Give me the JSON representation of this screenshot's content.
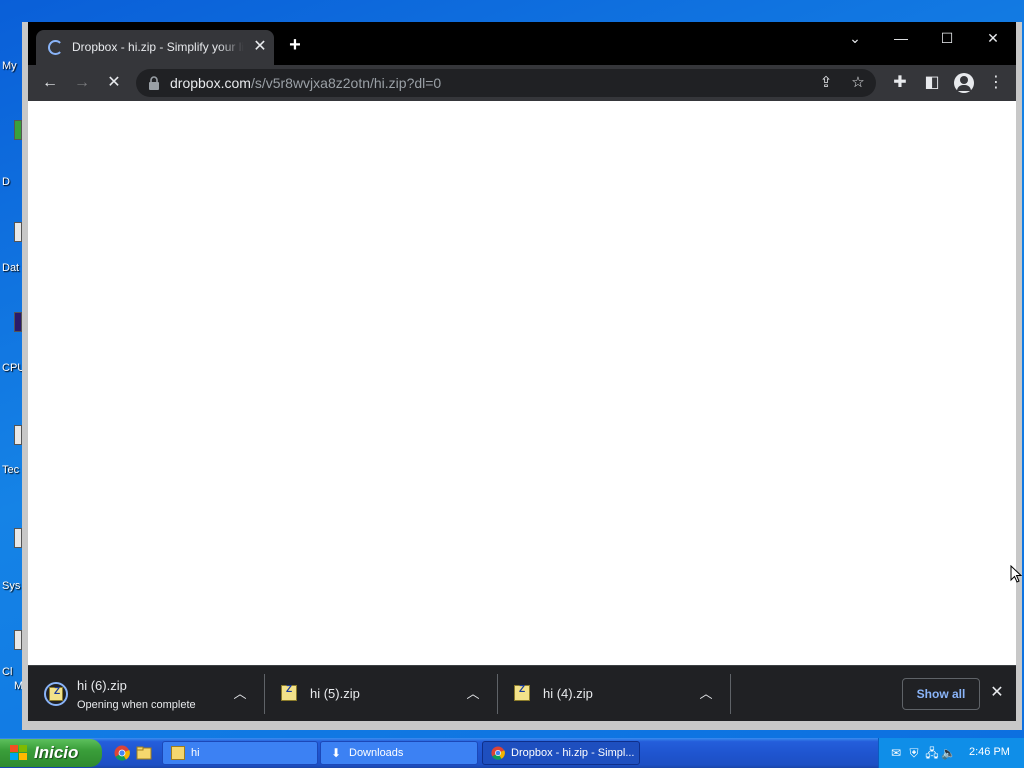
{
  "desktop": {
    "labels": [
      "My",
      "D",
      "Dat",
      "CPU",
      "Tec",
      "Sys",
      "Cl",
      "M"
    ]
  },
  "browser": {
    "tab": {
      "title": "Dropbox - hi.zip - Simplify your life"
    },
    "new_tab_icon": "plus-icon",
    "window_controls": {
      "tab_search": "chevron-down-icon",
      "minimize": "minimize-icon",
      "maximize": "maximize-icon",
      "close": "close-icon"
    },
    "address": {
      "host": "dropbox.com",
      "path": "/s/v5r8wvjxa8z2otn/hi.zip?dl=0"
    },
    "toolbar_icons": [
      "back-icon",
      "forward-icon",
      "stop-loading-icon",
      "share-icon",
      "bookmark-star-icon",
      "extensions-icon",
      "side-panel-icon",
      "profile-icon",
      "menu-icon"
    ]
  },
  "downloads": {
    "items": [
      {
        "name": "hi (6).zip",
        "status": "Opening when complete"
      },
      {
        "name": "hi (5).zip",
        "status": ""
      },
      {
        "name": "hi (4).zip",
        "status": ""
      }
    ],
    "show_all_label": "Show all"
  },
  "taskbar": {
    "start_label": "Inicio",
    "tasks": [
      {
        "label": "hi"
      },
      {
        "label": "Downloads"
      },
      {
        "label": "Dropbox - hi.zip - Simpl..."
      }
    ],
    "clock": "2:46 PM"
  },
  "colors": {
    "desktop": "#1583e6",
    "tabbar": "#000000",
    "toolbar": "#35363a",
    "omnibox": "#202124",
    "accent_blue": "#8ab4f8",
    "start_green": "#3a9e3a",
    "taskbar_blue": "#245edb"
  }
}
